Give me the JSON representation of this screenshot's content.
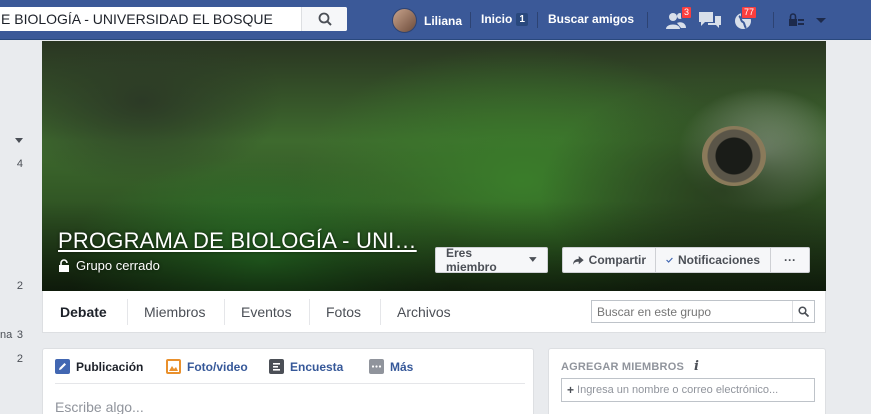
{
  "topbar": {
    "search_value": "E BIOLOGÍA - UNIVERSIDAD EL BOSQUE",
    "user_name": "Liliana",
    "home_label": "Inicio",
    "home_count": "1",
    "find_friends_label": "Buscar amigos",
    "friend_requests_badge": "3",
    "notifications_badge": "77",
    "brand_color": "#3b5998",
    "badge_color": "#fa3e3e"
  },
  "left_sidebar": {
    "counts": [
      "4",
      "2",
      "3",
      "2"
    ],
    "truncated_label": "na"
  },
  "cover": {
    "group_name": "PROGRAMA DE BIOLOGÍA - UNI…",
    "privacy": "Grupo cerrado",
    "member_button": "Eres miembro",
    "share_button": "Compartir",
    "notifications_button": "Notificaciones",
    "more_button": "···"
  },
  "tabs": {
    "items": [
      {
        "label": "Debate"
      },
      {
        "label": "Miembros"
      },
      {
        "label": "Eventos"
      },
      {
        "label": "Fotos"
      },
      {
        "label": "Archivos"
      }
    ],
    "active": "Debate",
    "search_placeholder": "Buscar en este grupo"
  },
  "composer": {
    "tabs": [
      "Publicación",
      "Foto/video",
      "Encuesta",
      "Más"
    ],
    "placeholder": "Escribe algo..."
  },
  "add_members": {
    "title": "AGREGAR MIEMBROS",
    "info_icon": "i",
    "input_placeholder": "Ingresa un nombre o correo electrónico..."
  }
}
